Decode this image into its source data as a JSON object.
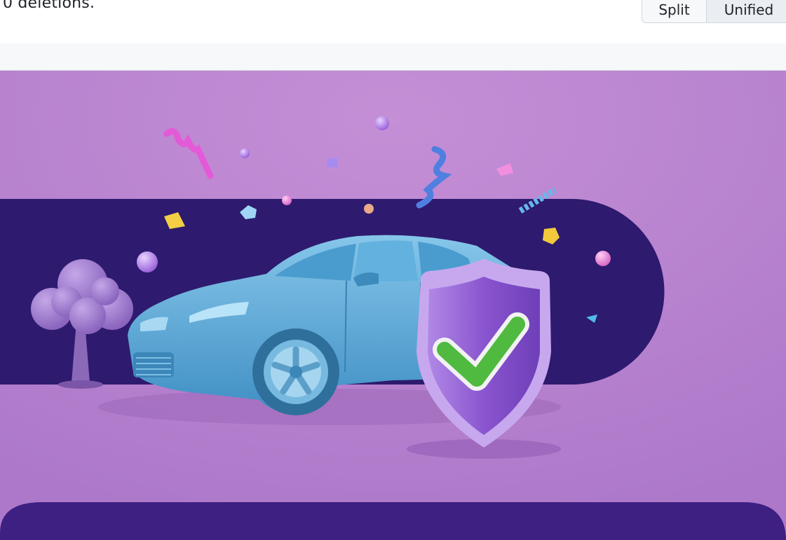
{
  "diff_summary": {
    "text": "0 deletions."
  },
  "view_toggle": {
    "split_label": "Split",
    "unified_label": "Unified",
    "selected": "Unified"
  },
  "image": {
    "subject": "car-insurance-celebration-illustration"
  },
  "colors": {
    "background_purple": "#b27fcc",
    "band_dark": "#2e1a6e",
    "bottom_band": "#3e1f82",
    "car_blue": "#5aaad6",
    "shield_purple": "#8e5ad1",
    "check_green": "#4fba3f",
    "tree_purple": "#9c7ac9"
  }
}
